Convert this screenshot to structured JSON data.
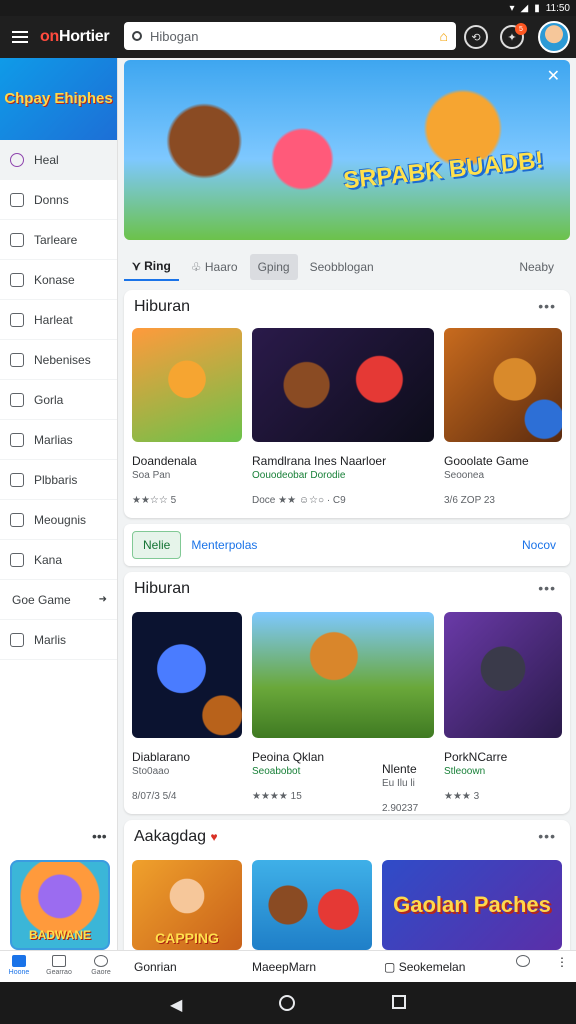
{
  "status_bar": {
    "time": "11:50"
  },
  "top_bar": {
    "logo_prefix": "on",
    "logo_main": "Hortier",
    "search_placeholder": "Hibogan",
    "notification_count": "5"
  },
  "sidebar": {
    "banner_text": "Chpay Ehiphes",
    "items": [
      {
        "label": "Heal"
      },
      {
        "label": "Donns"
      },
      {
        "label": "Tarleare"
      },
      {
        "label": "Konase"
      },
      {
        "label": "Harleat"
      },
      {
        "label": "Nebenises"
      },
      {
        "label": "Gorla"
      },
      {
        "label": "Marlias"
      },
      {
        "label": "Plbbaris"
      },
      {
        "label": "Meougnis"
      },
      {
        "label": "Kana"
      },
      {
        "label": "Goe Game",
        "arrow": "➜"
      },
      {
        "label": "Marlis"
      }
    ],
    "thumb_text": "BADWANE"
  },
  "hero": {
    "title": "SRPABK BUADB!"
  },
  "tabs": [
    {
      "label": "Ring"
    },
    {
      "label": "Haaro"
    },
    {
      "label": "Gping"
    },
    {
      "label": "Seobblogan"
    },
    {
      "label": "Neaby"
    }
  ],
  "section1": {
    "title": "Hiburan",
    "items": [
      {
        "title": "Doandenala",
        "subtitle": "Soa Pan",
        "meta": "★★☆☆ 5",
        "color": "#6bc24a"
      },
      {
        "title": "Ramdlrana Ines Naarloer",
        "subtitle": "Oouodeobar Dorodie",
        "meta": "Doce ★★ ☺☆○ · C9",
        "color": "#2a1a4a"
      },
      {
        "title": "Gooolate Game",
        "subtitle": "Seoonea",
        "meta": "3/6 ZOP 23",
        "color": "#c86b1e"
      }
    ]
  },
  "chipbar": {
    "chip": "Nelie",
    "link": "Menterpolas",
    "right": "Nocov"
  },
  "section2": {
    "title": "Hiburan",
    "items": [
      {
        "title": "Diablarano",
        "subtitle": "Sto0aao",
        "meta": "8/07/3 5/4",
        "color": "#0b1330"
      },
      {
        "title": "Peoina Qklan",
        "subtitle": "Seoabobot",
        "meta": "★★★★ 15",
        "extra_title": "Nlente",
        "extra_subtitle": "Eu Ilu li",
        "extra_meta": "2.90237",
        "color": "#6aa83a"
      },
      {
        "title": "PorkNCarre",
        "subtitle": "Stleoown",
        "meta": "★★★ 3",
        "color": "#6a3aa8"
      }
    ]
  },
  "section3": {
    "title": "Aakagdag",
    "items": [
      {
        "title": "CAPPING",
        "color": "#f0a12c"
      },
      {
        "title": "",
        "color": "#3fb0e8"
      },
      {
        "title": "Gaolan Paches",
        "color": "#2f4cc8"
      }
    ]
  },
  "bottom_nav": {
    "items": [
      {
        "label": "Hoone"
      },
      {
        "label": "Gearrao"
      },
      {
        "label": "Gaore"
      }
    ],
    "labels": [
      "Gonrian",
      "MaeepMarn",
      "Seokemelan"
    ]
  }
}
